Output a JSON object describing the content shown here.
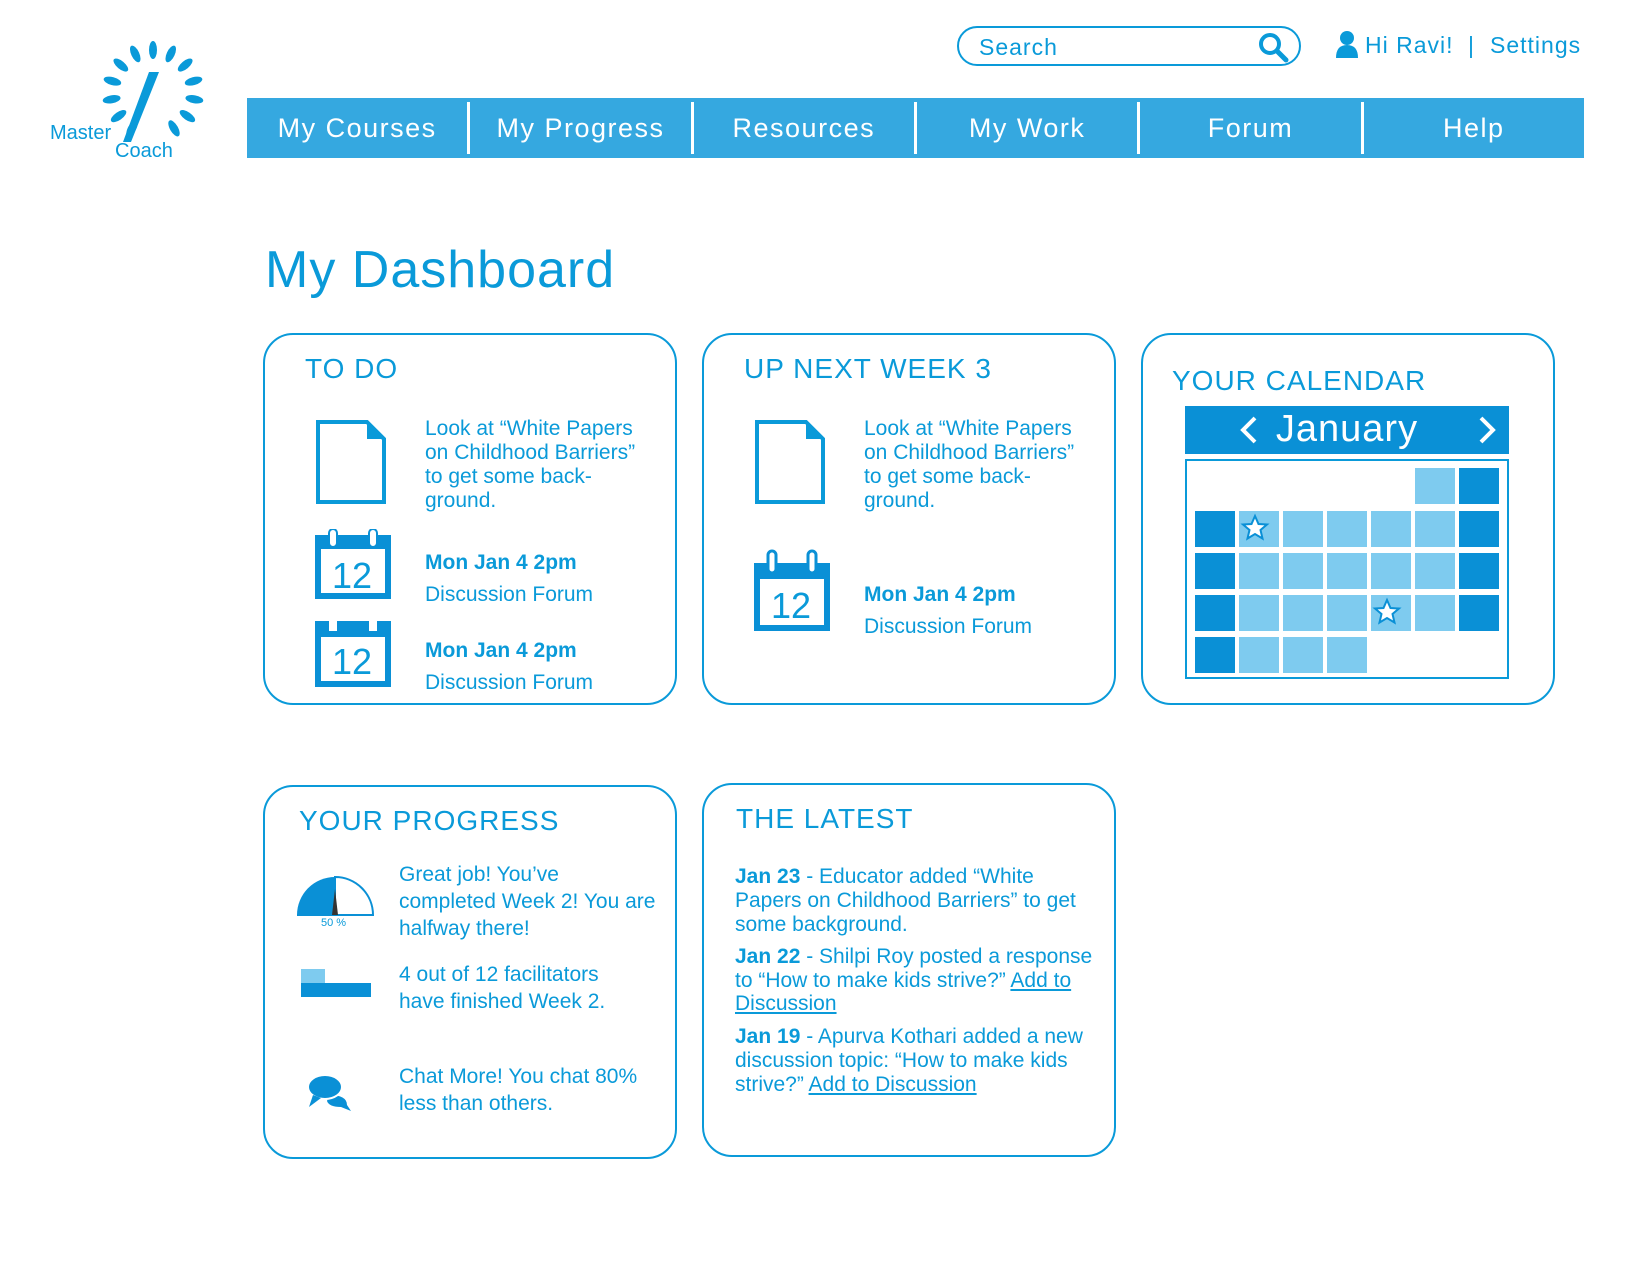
{
  "brand": {
    "line1": "Master",
    "line2": "Coach",
    "logo_icon": "sunburst-logo-icon",
    "accent": "#0a9ad9"
  },
  "header": {
    "search_placeholder": "Search",
    "greeting": "Hi Ravi!",
    "separator": "|",
    "settings": "Settings"
  },
  "nav": [
    "My Courses",
    "My Progress",
    "Resources",
    "My Work",
    "Forum",
    "Help"
  ],
  "page_title": "My Dashboard",
  "todo": {
    "title": "TO DO",
    "doc_text_1": "Look at “White Papers",
    "doc_text_2": "on Childhood Barriers”",
    "doc_text_3": "to get  some back-",
    "doc_text_4": "ground.",
    "event1": {
      "date": "Mon Jan 4 2pm",
      "label": "Discussion Forum",
      "day": "12"
    },
    "event2": {
      "date": "Mon Jan 4 2pm",
      "label": "Discussion Forum",
      "day": "12"
    }
  },
  "upnext": {
    "title": "UP NEXT WEEK 3",
    "doc_text_1": "Look at “White Papers",
    "doc_text_2": "on Childhood Barriers”",
    "doc_text_3": "to get  some back-",
    "doc_text_4": "ground.",
    "event": {
      "date": "Mon Jan 4 2pm",
      "label": "Discussion Forum",
      "day": "12"
    }
  },
  "calendar": {
    "title": "YOUR CALENDAR",
    "month": "January",
    "starred_days": 2
  },
  "progress": {
    "title": "YOUR PROGRESS",
    "gauge_label": "50 %",
    "gauge_value": 0.5,
    "msg1_l1": "Great job! You’ve",
    "msg1_l2": "completed Week 2! You are",
    "msg1_l3": "halfway there!",
    "msg2_l1": "4 out of 12 facilitators",
    "msg2_l2": "have finished Week 2.",
    "facilitators_done": 4,
    "facilitators_total": 12,
    "msg3_l1": "Chat More! You chat 80%",
    "msg3_l2": "less than others."
  },
  "latest": {
    "title": "THE LATEST",
    "item1": {
      "date": "Jan 23",
      "l1": " - Educator added “White",
      "l2": "Papers on Childhood Barriers” to get",
      "l3": "some background."
    },
    "item2": {
      "date": "Jan 22",
      "l1": " - Shilpi Roy posted a response",
      "l2": "to “How to make kids strive?” ",
      "link_a": "Add to",
      "link_b": "Discussion"
    },
    "item3": {
      "date": "Jan 19",
      "l1": " - Apurva Kothari added a new",
      "l2": "discussion topic: “How to make kids",
      "l3": "strive?” ",
      "link": "Add to Discussion"
    }
  }
}
